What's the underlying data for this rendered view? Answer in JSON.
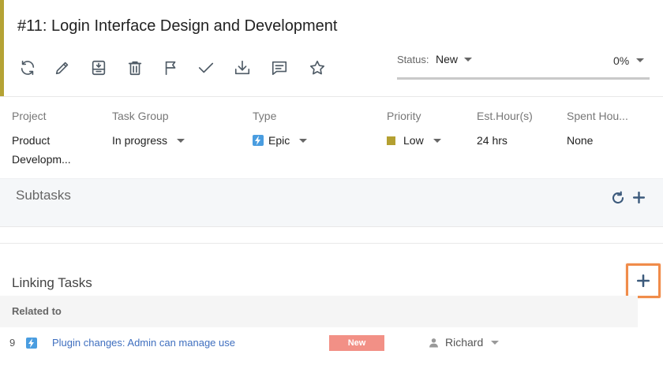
{
  "task": {
    "title": "#11: Login Interface Design and Development",
    "accent_color": "#b5a335"
  },
  "toolbar": {
    "icons": [
      "refresh-icon",
      "edit-icon",
      "archive-icon",
      "delete-icon",
      "flag-icon",
      "check-icon",
      "download-icon",
      "comment-icon",
      "star-icon"
    ]
  },
  "status": {
    "label": "Status:",
    "value": "New",
    "progress_text": "0%",
    "progress_fraction": 0
  },
  "properties": {
    "project": {
      "label": "Project",
      "value_line1": "Product",
      "value_line2": "Developm..."
    },
    "task_group": {
      "label": "Task Group",
      "value": "In progress"
    },
    "type": {
      "label": "Type",
      "value": "Epic",
      "icon": "lightning-icon",
      "icon_color": "#4a9de0"
    },
    "priority": {
      "label": "Priority",
      "value": "Low",
      "color": "#b4a031"
    },
    "est_hours": {
      "label": "Est.Hour(s)",
      "value": "24 hrs"
    },
    "spent_hours": {
      "label": "Spent Hou...",
      "value": "None"
    }
  },
  "subtasks": {
    "title": "Subtasks",
    "icons": [
      "refresh-icon",
      "plus-icon"
    ]
  },
  "linking": {
    "title": "Linking Tasks",
    "add_icon": "plus-icon",
    "highlight_color": "#f08c4a",
    "groups": [
      {
        "label": "Related to",
        "rows": [
          {
            "id": "9",
            "icon": "lightning-icon",
            "title": "Plugin changes: Admin can manage use",
            "status": "New",
            "status_color": "#f29086",
            "assignee": "Richard"
          }
        ]
      }
    ]
  }
}
